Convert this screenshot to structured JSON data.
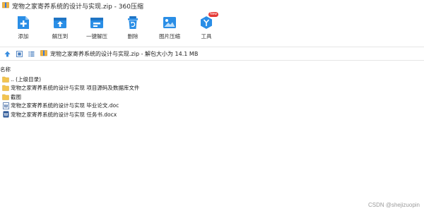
{
  "window": {
    "title": "宠物之家寄养系统的设计与实现.zip - 360压缩"
  },
  "toolbar": {
    "items": [
      {
        "label": "添加",
        "icon": "add-icon"
      },
      {
        "label": "解压到",
        "icon": "extract-to-icon"
      },
      {
        "label": "一键解压",
        "icon": "one-click-extract-icon"
      },
      {
        "label": "删除",
        "icon": "delete-icon"
      },
      {
        "label": "图片压缩",
        "icon": "image-compress-icon"
      },
      {
        "label": "工具",
        "icon": "tools-icon",
        "badge": "New"
      }
    ]
  },
  "addressbar": {
    "path": "宠物之家寄养系统的设计与实现.zip - 解包大小为 14.1 MB"
  },
  "list": {
    "column_name": "名称",
    "items": [
      {
        "name": ".. (上级目录)",
        "type": "folder"
      },
      {
        "name": "宠物之家寄养系统的设计与实现 项目源码及数据库文件",
        "type": "folder"
      },
      {
        "name": "截图",
        "type": "folder"
      },
      {
        "name": "宠物之家寄养系统的设计与实现 毕业论文.doc",
        "type": "doc"
      },
      {
        "name": "宠物之家寄养系统的设计与实现 任务书.docx",
        "type": "docx"
      }
    ]
  },
  "watermark": "CSDN @shejizuopin",
  "colors": {
    "toolbar_blue": "#2a8ee6",
    "folder_yellow": "#f3c44f",
    "word_blue": "#2b5797",
    "badge_red": "#e53935"
  }
}
